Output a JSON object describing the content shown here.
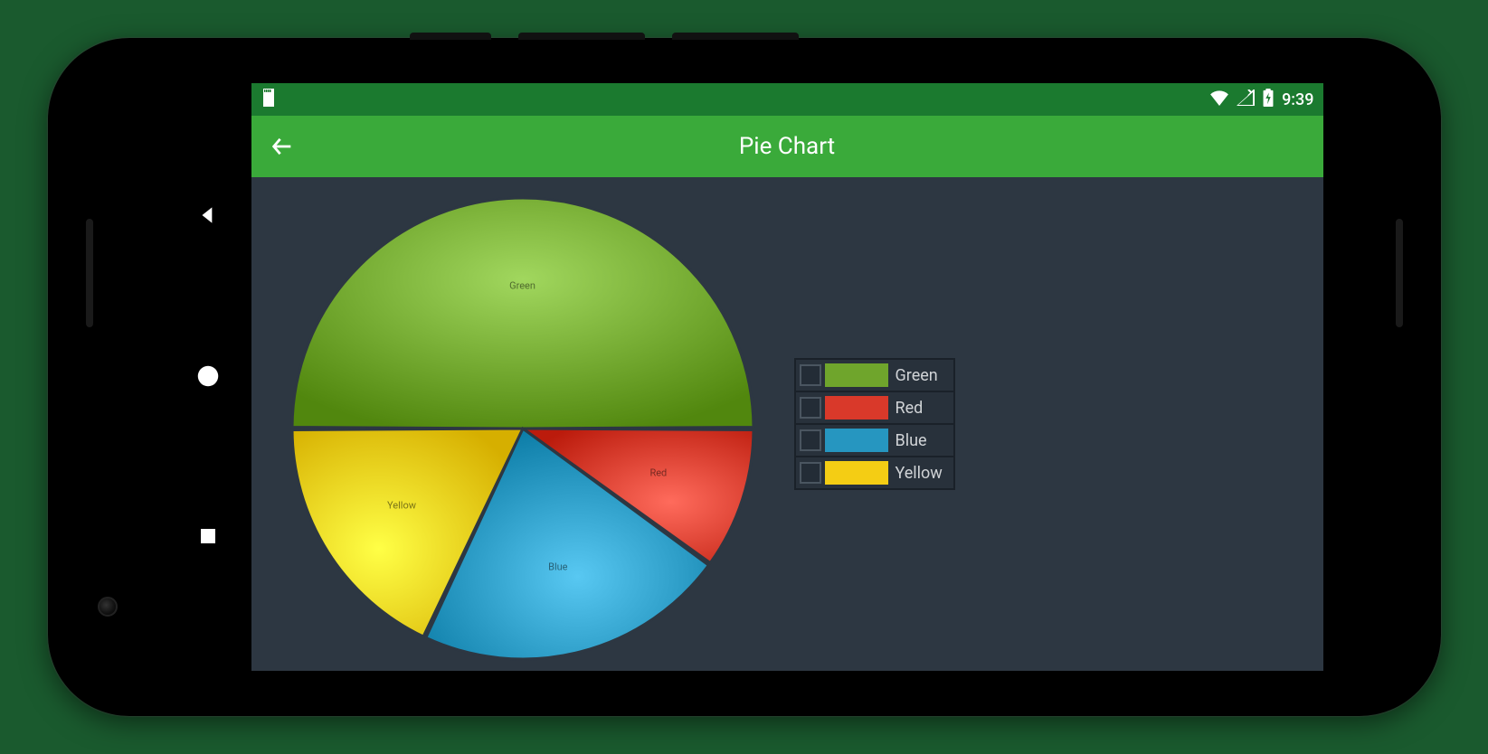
{
  "status": {
    "time": "9:39"
  },
  "actionbar": {
    "title": "Pie Chart"
  },
  "chart_data": {
    "type": "pie",
    "series": [
      {
        "name": "Green",
        "value": 50,
        "color": "#6fa52c"
      },
      {
        "name": "Red",
        "value": 10,
        "color": "#d9392a"
      },
      {
        "name": "Blue",
        "value": 22,
        "color": "#2696c0"
      },
      {
        "name": "Yellow",
        "value": 18,
        "color": "#f4cd14"
      }
    ],
    "legend_position": "right",
    "start_angle_deg": 180
  },
  "legend": {
    "items": [
      {
        "label": "Green",
        "color": "#6fa52c"
      },
      {
        "label": "Red",
        "color": "#d9392a"
      },
      {
        "label": "Blue",
        "color": "#2696c0"
      },
      {
        "label": "Yellow",
        "color": "#f4cd14"
      }
    ]
  }
}
